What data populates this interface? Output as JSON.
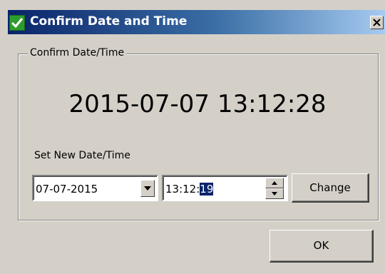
{
  "window": {
    "title": "Confirm Date and Time",
    "close_glyph": "×",
    "app_icon": "green-checkmark-icon"
  },
  "group": {
    "legend": "Confirm Date/Time",
    "current_datetime": "2015-07-07 13:12:28",
    "set_label": "Set New Date/Time"
  },
  "date_combo": {
    "value": "07-07-2015",
    "arrow_icon": "chevron-down-icon"
  },
  "time_field": {
    "prefix": "13:12:",
    "selected": "19",
    "spin_up_icon": "spin-up-icon",
    "spin_down_icon": "spin-down-icon"
  },
  "buttons": {
    "change_label": "Change",
    "ok_label": "OK"
  },
  "colors": {
    "titlebar_start": "#0a246a",
    "titlebar_end": "#a6caf0",
    "dialog_face": "#d4d0c8",
    "selection": "#0a246a",
    "icon_green": "#2e9c2e"
  }
}
